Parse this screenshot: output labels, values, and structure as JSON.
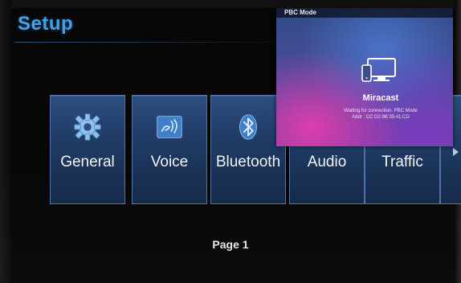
{
  "header": {
    "title": "Setup"
  },
  "tiles": [
    {
      "label": "General",
      "icon": "gear-icon"
    },
    {
      "label": "Voice",
      "icon": "voice-icon"
    },
    {
      "label": "Bluetooth",
      "icon": "bluetooth-icon"
    },
    {
      "label": "Audio",
      "icon": "audio-icon"
    },
    {
      "label": "Traffic",
      "icon": "traffic-icon"
    }
  ],
  "pagination": {
    "label": "Page 1"
  },
  "pip_overlay": {
    "header": "PBC Mode",
    "app_name": "Miracast",
    "status": "Waiting for connection. PBC Mode",
    "address": "Addr : CC:D2:9B:35:41:CD",
    "icon": "miracast-display-icon"
  },
  "colors": {
    "title": "#4a9fe0",
    "tile_top": "#2c4d7e",
    "tile_bottom": "#15294a",
    "background": "#070707"
  }
}
